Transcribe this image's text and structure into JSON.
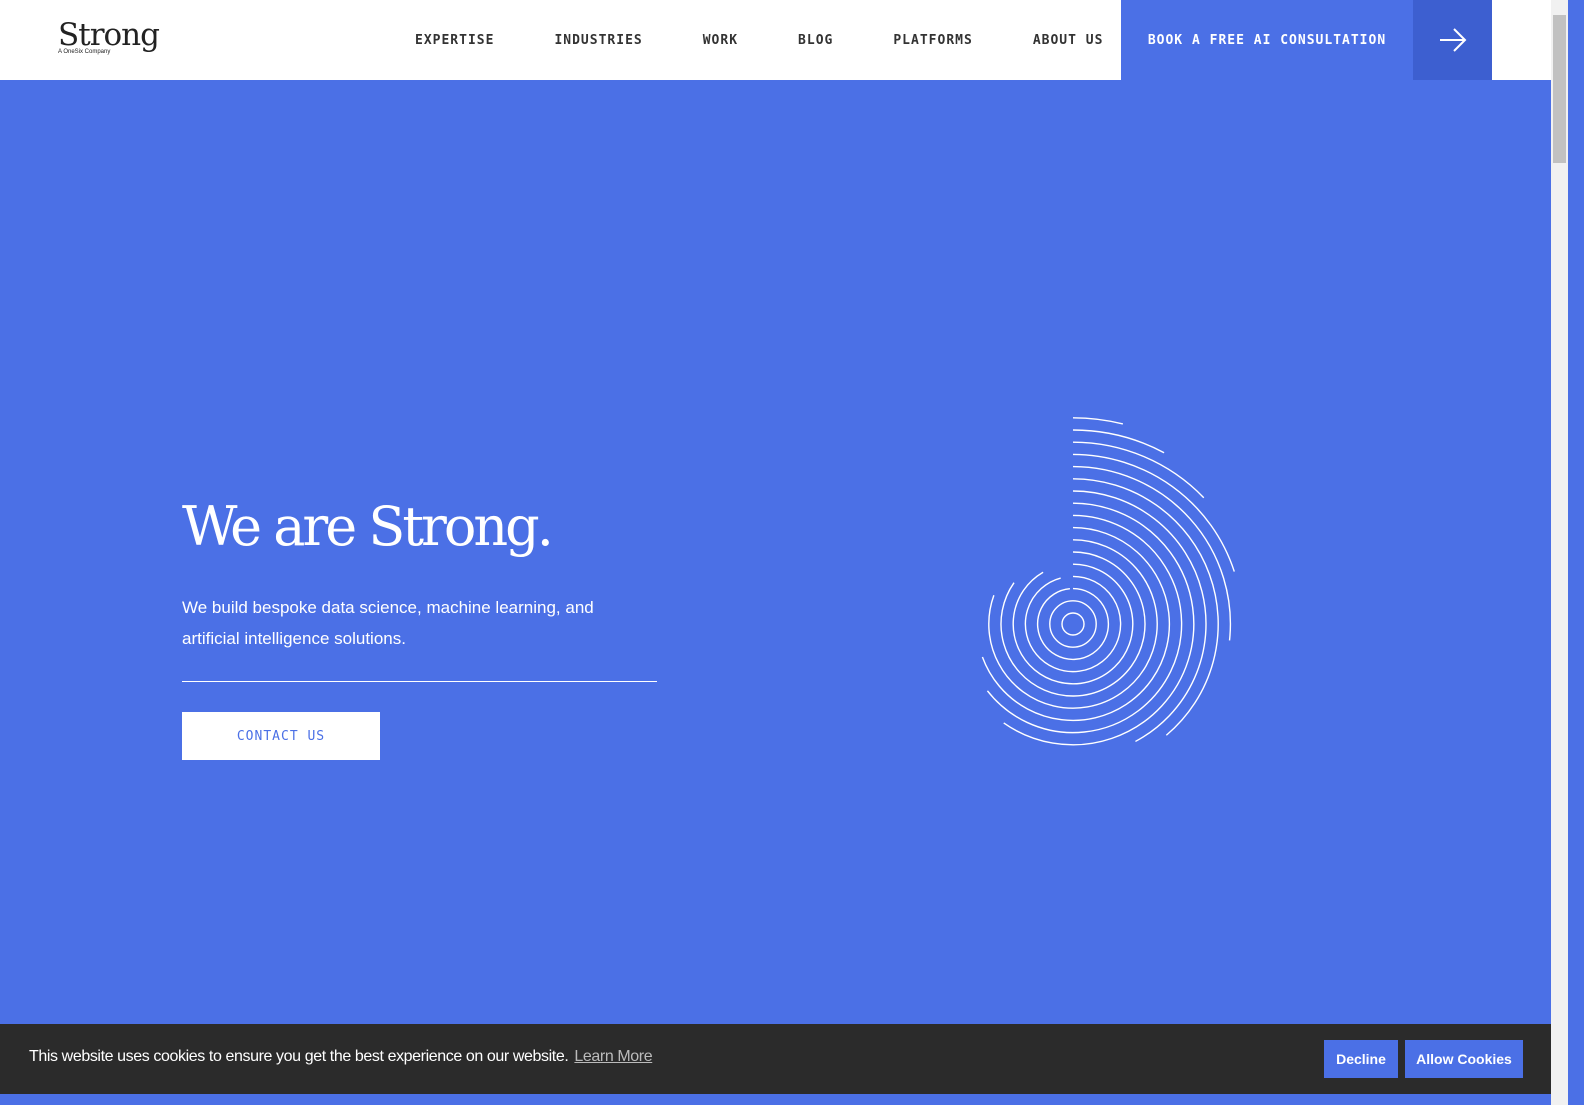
{
  "header": {
    "logo": "Strong",
    "logo_sub": "A OneSix Company",
    "nav": [
      "EXPERTISE",
      "INDUSTRIES",
      "WORK",
      "BLOG",
      "PLATFORMS",
      "ABOUT US"
    ],
    "cta": "BOOK A FREE AI CONSULTATION",
    "cta_icon": "arrow-right-icon"
  },
  "hero": {
    "title": "We are Strong.",
    "subtitle": "We build bespoke data science, machine learning, and artificial intelligence solutions.",
    "contact": "CONTACT US"
  },
  "cookie": {
    "message": "This website uses cookies to ensure you get the best experience on our website.",
    "learn_more": "Learn More",
    "decline": "Decline",
    "allow": "Allow Cookies"
  },
  "colors": {
    "brand": "#4b70e6",
    "cookie_bg": "#2b2b2b"
  }
}
